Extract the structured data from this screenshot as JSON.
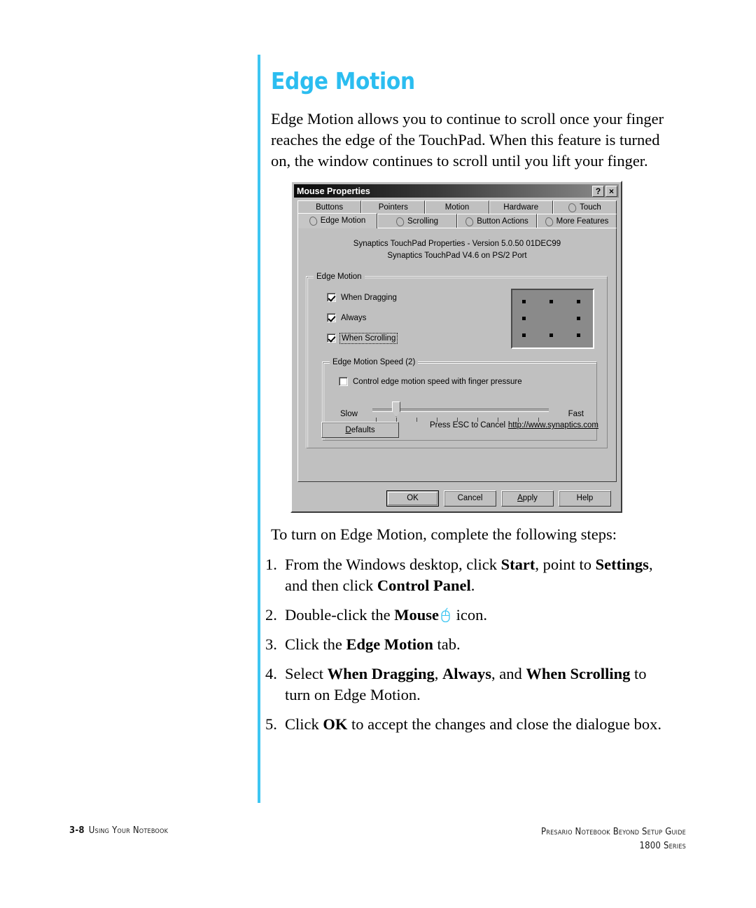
{
  "page": {
    "heading": "Edge Motion",
    "intro": "Edge Motion allows you to continue to scroll once your finger reaches the edge of the TouchPad. When this feature is turned on, the window continues to scroll until you lift your finger.",
    "lead_in": "To turn on Edge Motion, complete the following steps:",
    "accent_color": "#2bbdf0",
    "rule_color": "#3ec6f2"
  },
  "dialog": {
    "title": "Mouse Properties",
    "help_button": "?",
    "close_button": "×",
    "tabs_row1": [
      {
        "label": "Buttons",
        "has_icon": false,
        "active": false
      },
      {
        "label": "Pointers",
        "has_icon": false,
        "active": false
      },
      {
        "label": "Motion",
        "has_icon": false,
        "active": false
      },
      {
        "label": "Hardware",
        "has_icon": false,
        "active": false
      },
      {
        "label": "Touch",
        "has_icon": true,
        "active": false
      }
    ],
    "tabs_row2": [
      {
        "label": "Edge Motion",
        "has_icon": true,
        "active": true
      },
      {
        "label": "Scrolling",
        "has_icon": true,
        "active": false
      },
      {
        "label": "Button Actions",
        "has_icon": true,
        "active": false
      },
      {
        "label": "More Features",
        "has_icon": true,
        "active": false
      }
    ],
    "version_line1": "Synaptics TouchPad Properties - Version 5.0.50 01DEC99",
    "version_line2": "Synaptics TouchPad V4.6 on PS/2 Port",
    "edge_motion_group": {
      "title": "Edge Motion",
      "checkboxes": [
        {
          "label": "When Dragging",
          "checked": true,
          "focused": false
        },
        {
          "label": "Always",
          "checked": true,
          "focused": false
        },
        {
          "label": "When Scrolling",
          "checked": true,
          "focused": true
        }
      ]
    },
    "speed_group": {
      "title": "Edge Motion Speed (2)",
      "pressure_checkbox": {
        "label": "Control edge motion speed with finger pressure",
        "checked": false
      },
      "slider": {
        "min_label": "Slow",
        "max_label": "Fast",
        "value": 2,
        "tick_count": 9
      }
    },
    "defaults_button": "Defaults",
    "esc_note": "Press ESC to Cancel",
    "link": "http://www.synaptics.com",
    "buttons": [
      {
        "label": "OK",
        "default": true
      },
      {
        "label": "Cancel",
        "default": false
      },
      {
        "label": "Apply",
        "default": false
      },
      {
        "label": "Help",
        "default": false
      }
    ]
  },
  "steps": [
    {
      "num": "1.",
      "parts": [
        {
          "t": "From the Windows desktop, click ",
          "b": false
        },
        {
          "t": "Start",
          "b": true
        },
        {
          "t": ", point to ",
          "b": false
        },
        {
          "t": "Settings",
          "b": true
        },
        {
          "t": ", and then click ",
          "b": false
        },
        {
          "t": "Control Panel",
          "b": true
        },
        {
          "t": ".",
          "b": false
        }
      ]
    },
    {
      "num": "2.",
      "parts": [
        {
          "t": "Double-click the ",
          "b": false
        },
        {
          "t": "Mouse",
          "b": true
        },
        {
          "t": "MOUSE_ICON",
          "b": false
        },
        {
          "t": " icon.",
          "b": false
        }
      ]
    },
    {
      "num": "3.",
      "parts": [
        {
          "t": "Click the ",
          "b": false
        },
        {
          "t": "Edge Motion",
          "b": true
        },
        {
          "t": " tab.",
          "b": false
        }
      ]
    },
    {
      "num": "4.",
      "parts": [
        {
          "t": "Select ",
          "b": false
        },
        {
          "t": "When Dragging",
          "b": true
        },
        {
          "t": ", ",
          "b": false
        },
        {
          "t": "Always",
          "b": true
        },
        {
          "t": ", and ",
          "b": false
        },
        {
          "t": "When Scrolling",
          "b": true
        },
        {
          "t": " to turn on Edge Motion.",
          "b": false
        }
      ]
    },
    {
      "num": "5.",
      "parts": [
        {
          "t": "Click ",
          "b": false
        },
        {
          "t": "OK",
          "b": true
        },
        {
          "t": " to accept the changes and close the dialogue box.",
          "b": false
        }
      ]
    }
  ],
  "footer": {
    "page_number": "3-8",
    "section": "Using Your Notebook",
    "guide_title": "Presario Notebook Beyond Setup Guide",
    "series": "1800 Series"
  }
}
